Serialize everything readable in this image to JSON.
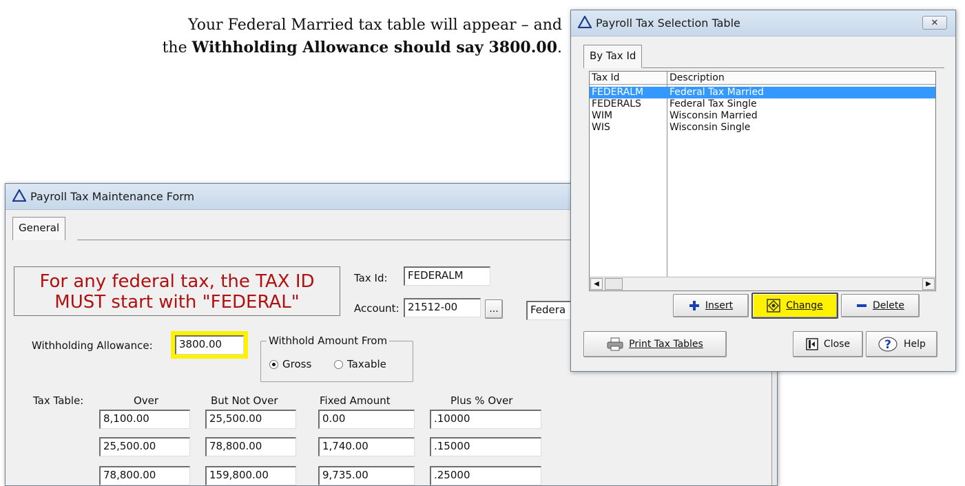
{
  "caption": {
    "line1": "Your Federal Married tax table will appear – and",
    "line2_prefix": "the ",
    "line2_bold": "Withholding Allowance should say 3800.00",
    "line2_suffix": "."
  },
  "maintenance_form": {
    "title": "Payroll Tax Maintenance Form",
    "tab": "General",
    "notice_line1": "For any federal tax, the TAX ID",
    "notice_line2": "MUST start with \"FEDERAL\"",
    "tax_id_label": "Tax Id:",
    "tax_id_value": "FEDERALM",
    "account_label": "Account:",
    "account_value": "21512-00",
    "browse_label": "...",
    "account_desc_value": "Federa",
    "withholding_label": "Withholding Allowance:",
    "withholding_value": "3800.00",
    "withhold_from_title": "Withhold Amount From",
    "radio_gross": "Gross",
    "radio_taxable": "Taxable",
    "selected_radio": "Gross",
    "tax_table_label": "Tax Table:",
    "columns": [
      "Over",
      "But Not Over",
      "Fixed Amount",
      "Plus % Over"
    ],
    "rows": [
      [
        "8,100.00",
        "25,500.00",
        "0.00",
        ".10000"
      ],
      [
        "25,500.00",
        "78,800.00",
        "1,740.00",
        ".15000"
      ],
      [
        "78,800.00",
        "159,800.00",
        "9,735.00",
        ".25000"
      ]
    ]
  },
  "selection_table": {
    "title": "Payroll Tax Selection Table",
    "close_glyph": "✕",
    "tab": "By Tax Id",
    "columns": [
      "Tax Id",
      "Description"
    ],
    "rows": [
      {
        "id": "FEDERALM",
        "desc": "Federal Tax Married",
        "selected": true
      },
      {
        "id": "FEDERALS",
        "desc": "Federal Tax Single",
        "selected": false
      },
      {
        "id": "WIM",
        "desc": "Wisconsin Married",
        "selected": false
      },
      {
        "id": "WIS",
        "desc": "Wisconsin Single",
        "selected": false
      }
    ],
    "buttons": {
      "insert": "Insert",
      "change": "Change",
      "delete": "Delete",
      "print": "Print Tax Tables",
      "close": "Close",
      "help": "Help"
    }
  },
  "colors": {
    "highlight": "#fff200",
    "notice_text": "#b01010",
    "list_selection": "#3399ff"
  }
}
